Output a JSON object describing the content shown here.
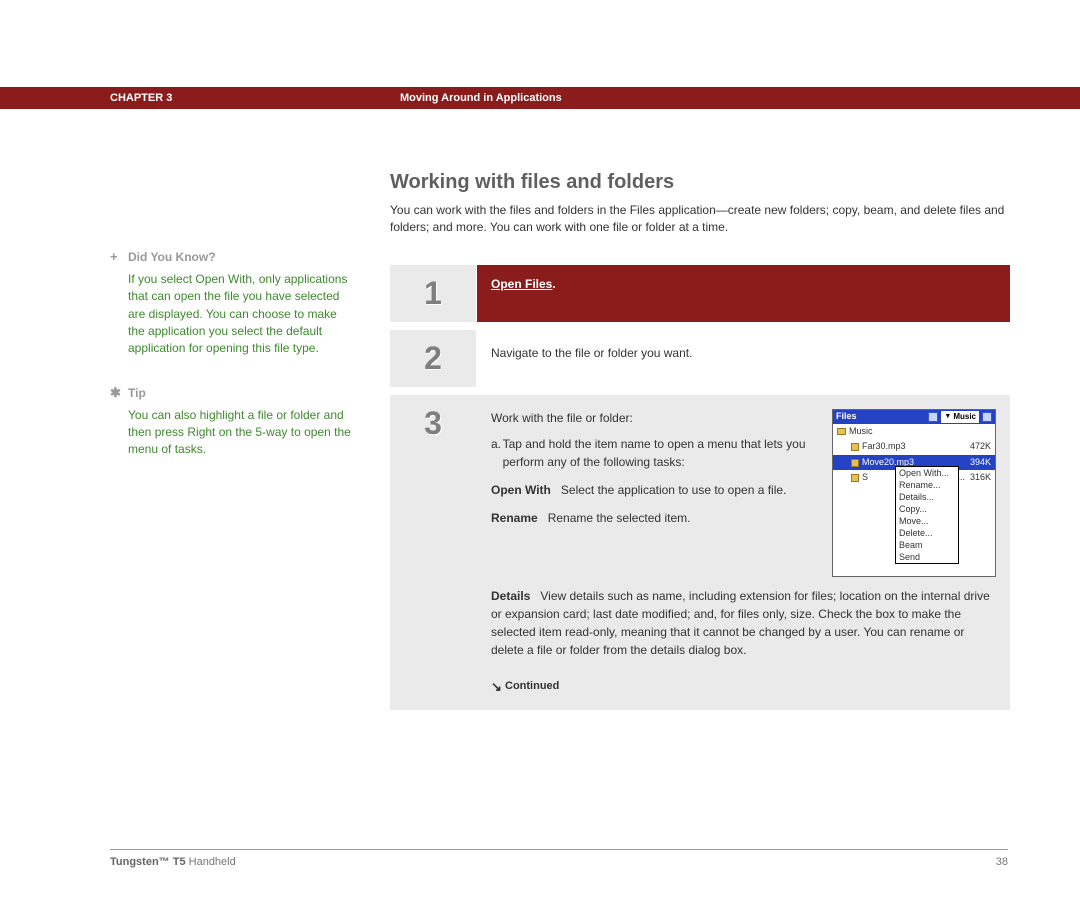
{
  "header": {
    "chapter": "CHAPTER 3",
    "title": "Moving Around in Applications"
  },
  "sidebar": {
    "dyk_label": "Did You Know?",
    "dyk_body": "If you select Open With, only applications that can open the file you have selected are displayed. You can choose to make the application you select the default application for opening this file type.",
    "tip_label": "Tip",
    "tip_body": "You can also highlight a file or folder and then press Right on the 5-way to open the menu of tasks."
  },
  "main": {
    "section_title": "Working with files and folders",
    "intro": "You can work with the files and folders in the Files application—create new folders; copy, beam, and delete files and folders; and more. You can work with one file or folder at a time.",
    "step1_num": "1",
    "step1_text": "Open Files",
    "step1_suffix": ".",
    "step2_num": "2",
    "step2_text": "Navigate to the file or folder you want.",
    "step3_num": "3",
    "step3_intro": "Work with the file or folder:",
    "step3_a_letter": "a.",
    "step3_a_text": "Tap and hold the item name to open a menu that lets you perform any of the following tasks:",
    "open_with_label": "Open With",
    "open_with_text": "Select the application to use to open a file.",
    "rename_label": "Rename",
    "rename_text": "Rename the selected item.",
    "details_label": "Details",
    "details_text": "View details such as name, including extension for files; location on the internal drive or expansion card; last date modified; and, for files only, size. Check the box to make the selected item read-only, meaning that it cannot be changed by a user. You can rename or delete a file or folder from the details dialog box.",
    "continued": "Continued"
  },
  "device": {
    "app_title": "Files",
    "dropdown": "Music",
    "folder": "Music",
    "file1_name": "Far30.mp3",
    "file1_size": "472K",
    "file2_name": "Move20.mp3",
    "file2_size": "394K",
    "file3_name_partial": "ght2...",
    "file3_size": "316K",
    "menu": [
      "Open With...",
      "Rename...",
      "Details...",
      "Copy...",
      "Move...",
      "Delete...",
      "Beam",
      "Send"
    ]
  },
  "footer": {
    "product_bold": "Tungsten™ T5",
    "product_rest": " Handheld",
    "page": "38"
  }
}
